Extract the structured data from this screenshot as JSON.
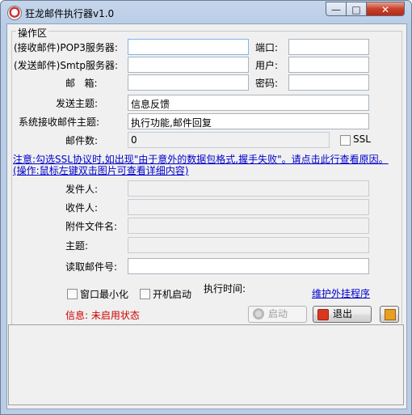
{
  "window": {
    "title": "狂龙邮件执行器v1.0",
    "minimize": "—",
    "maximize": "□",
    "close": "✕"
  },
  "group": {
    "legend": "操作区"
  },
  "form": {
    "pop3_label": "(接收邮件)POP3服务器:",
    "pop3_value": "",
    "port_label": "端口:",
    "port_value": "",
    "smtp_label": "(发送邮件)Smtp服务器:",
    "smtp_value": "",
    "user_label": "用户:",
    "user_value": "",
    "email_label": "邮   箱:",
    "email_value": "",
    "password_label": "密码:",
    "password_value": "",
    "send_subject_label": "发送主题:",
    "send_subject_value": "信息反馈",
    "recv_subject_label": "系统接收邮件主题:",
    "recv_subject_value": "执行功能,邮件回复",
    "mail_count_label": "邮件数:",
    "mail_count_value": "0",
    "ssl_label": "SSL"
  },
  "notice": {
    "line1": "注意:勾选SSL协议时,如出现\"由于意外的数据包格式,握手失败\"。请点击此行查看原因。",
    "line2": "(操作:鼠标左键双击图片可查看详细内容)"
  },
  "details": {
    "sender_label": "发件人:",
    "sender_value": "",
    "recipient_label": "收件人:",
    "recipient_value": "",
    "attachment_label": "附件文件名:",
    "attachment_value": "",
    "subject_label": "主题:",
    "subject_value": "",
    "read_mail_no_label": "读取邮件号:",
    "read_mail_no_value": ""
  },
  "options": {
    "minimize_window": "窗口最小化",
    "auto_start": "开机启动",
    "exec_time_label": "执行时间:",
    "maintain_link": "维护外挂程序"
  },
  "status": {
    "text": "信息: 未启用状态",
    "color": "#cc0000"
  },
  "buttons": {
    "start": "启动",
    "exit": "退出"
  }
}
